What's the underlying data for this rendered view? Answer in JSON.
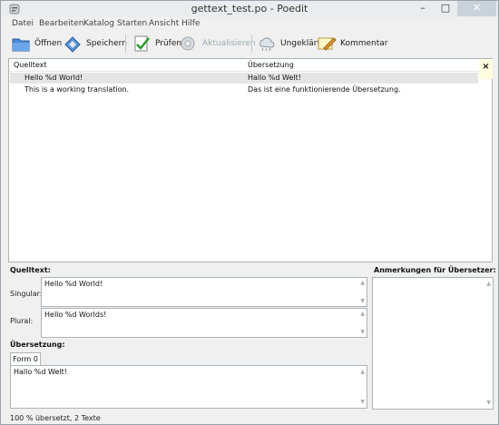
{
  "window": {
    "title": "gettext_test.po - Poedit",
    "minimize": "–",
    "maximize": "□",
    "close": "✕"
  },
  "menu": [
    "Datei",
    "Bearbeiten",
    "Katalog",
    "Starten",
    "Ansicht",
    "Hilfe"
  ],
  "toolbar": {
    "open": "Öffnen",
    "save": "Speichern",
    "validate": "Prüfen",
    "update": "Aktualisieren",
    "fuzzy": "Ungeklärt",
    "comment": "Kommentar"
  },
  "list": {
    "col_source": "Quelltext",
    "col_translation": "Übersetzung",
    "close_label": "×",
    "rows": [
      {
        "source": "Hello %d World!",
        "translation": "Hallo %d Welt!"
      },
      {
        "source": "This is a working translation.",
        "translation": "Das ist eine funktionierende Übersetzung."
      }
    ]
  },
  "source_section": {
    "heading": "Quelltext:",
    "singular_label": "Singular:",
    "singular_text": "Hello %d World!",
    "plural_label": "Plural:",
    "plural_text": "Hello %d Worlds!"
  },
  "translation_section": {
    "heading": "Übersetzung:",
    "tab_label": "Form 0",
    "text": "Hallo %d Welt!"
  },
  "notes": {
    "heading": "Anmerkungen für Übersetzer:"
  },
  "status": "100 % übersetzt, 2 Texte"
}
